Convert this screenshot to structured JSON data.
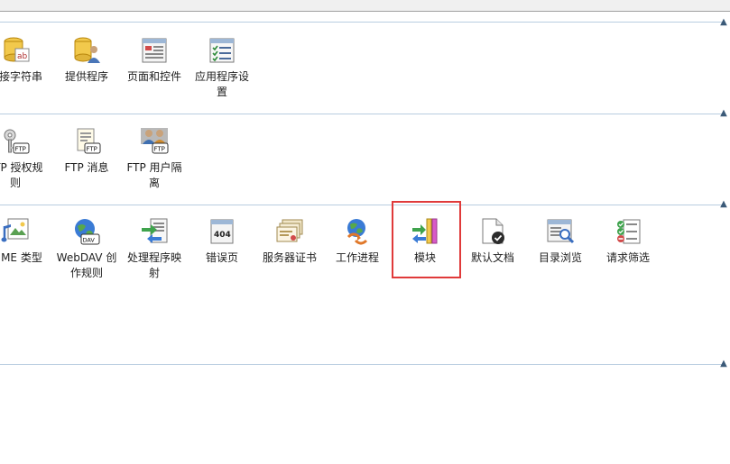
{
  "groups": [
    {
      "items": [
        {
          "label": "连接字符串",
          "icon": "connection-string-icon"
        },
        {
          "label": "提供程序",
          "icon": "providers-icon"
        },
        {
          "label": "页面和控件",
          "icon": "pages-controls-icon"
        },
        {
          "label": "应用程序设置",
          "icon": "app-settings-icon"
        }
      ]
    },
    {
      "items": [
        {
          "label": "FTP 授权规则",
          "icon": "ftp-authorization-icon"
        },
        {
          "label": "FTP 消息",
          "icon": "ftp-messages-icon"
        },
        {
          "label": "FTP 用户隔离",
          "icon": "ftp-user-isolation-icon"
        }
      ]
    },
    {
      "items": [
        {
          "label": "MIME 类型",
          "icon": "mime-types-icon"
        },
        {
          "label": "WebDAV 创作规则",
          "icon": "webdav-icon"
        },
        {
          "label": "处理程序映射",
          "icon": "handler-mappings-icon"
        },
        {
          "label": "错误页",
          "icon": "error-pages-icon"
        },
        {
          "label": "服务器证书",
          "icon": "server-certificates-icon"
        },
        {
          "label": "工作进程",
          "icon": "worker-processes-icon"
        },
        {
          "label": "模块",
          "icon": "modules-icon"
        },
        {
          "label": "默认文档",
          "icon": "default-document-icon"
        },
        {
          "label": "目录浏览",
          "icon": "directory-browsing-icon"
        },
        {
          "label": "请求筛选",
          "icon": "request-filtering-icon"
        }
      ]
    }
  ],
  "colors": {
    "separator": "#b8cde0",
    "highlight": "#e03a3a",
    "chevron": "#3b5a78"
  }
}
